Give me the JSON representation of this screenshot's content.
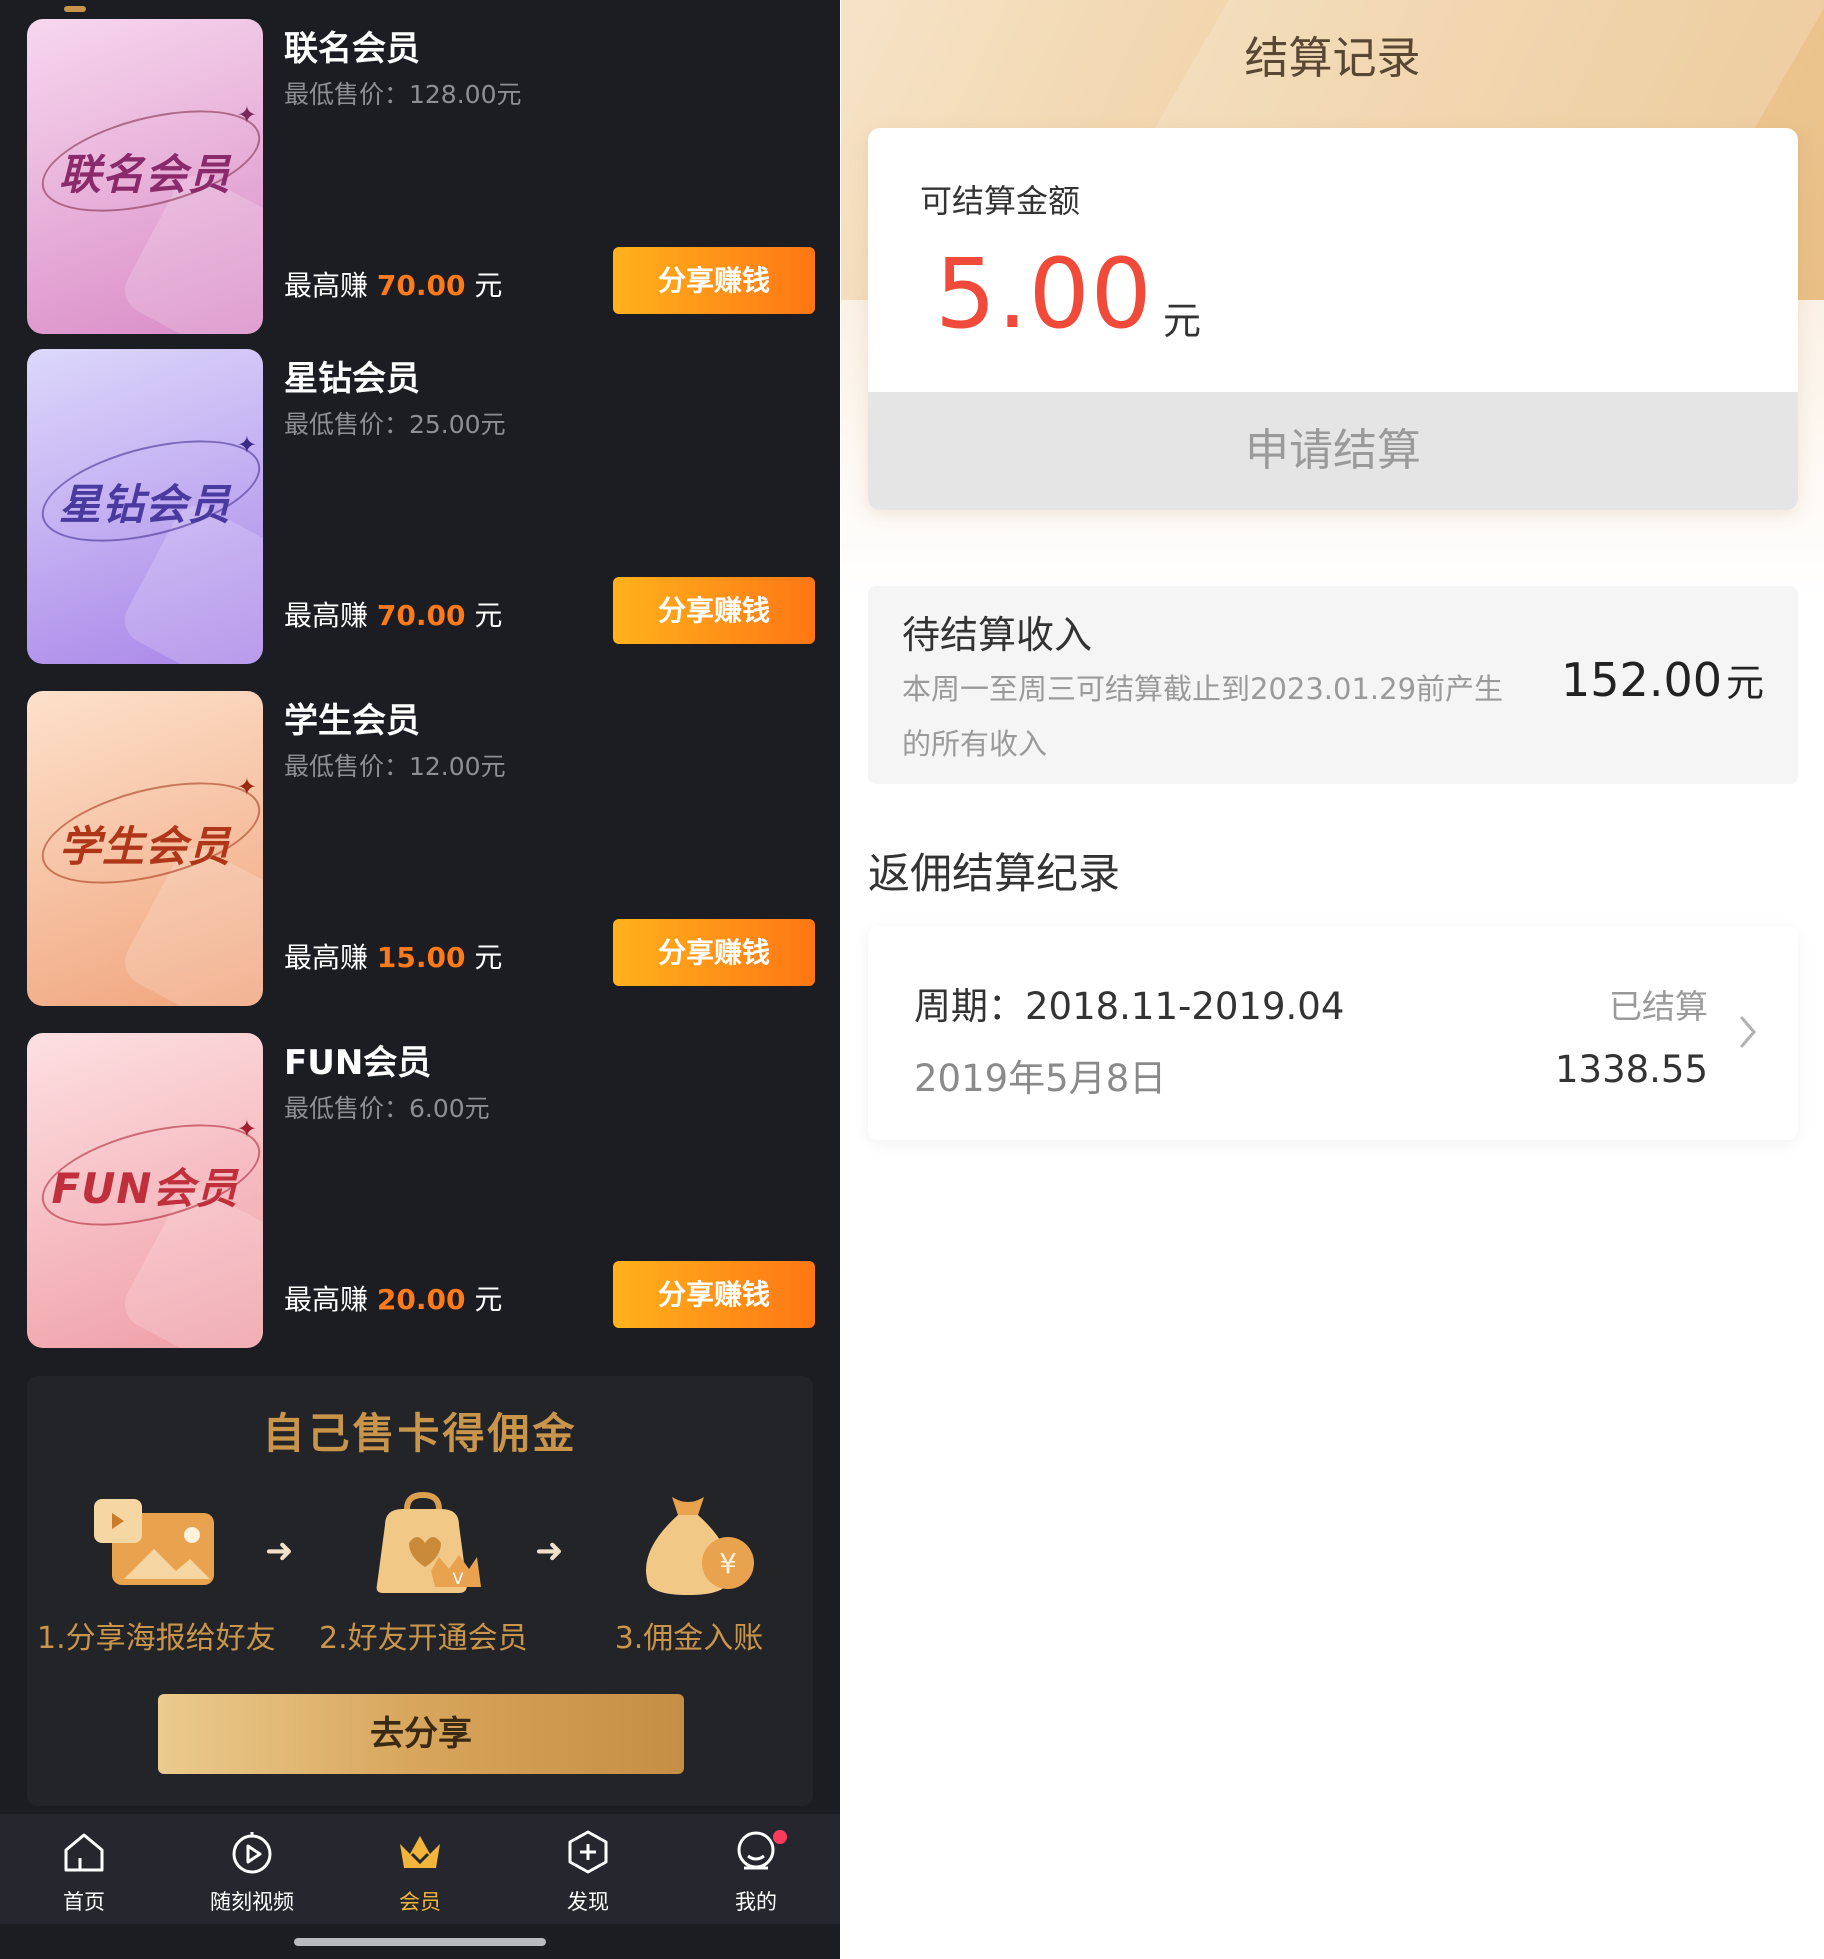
{
  "left": {
    "cards": [
      {
        "name": "联名会员",
        "thumb_text": "联名会员",
        "min_price": "最低售价：128.00元",
        "earn_prefix": "最高赚 ",
        "earn_amount": "70.00",
        "earn_unit": " 元",
        "button": "分享赚钱",
        "thumb_gradient": [
          "#f7d7ee",
          "#d98bc6"
        ],
        "thumb_text_color": "#8a2a6a"
      },
      {
        "name": "星钻会员",
        "thumb_text": "星钻会员",
        "min_price": "最低售价：25.00元",
        "earn_prefix": "最高赚 ",
        "earn_amount": "70.00",
        "earn_unit": " 元",
        "button": "分享赚钱",
        "thumb_gradient": [
          "#dcd8fb",
          "#a985e8"
        ],
        "thumb_text_color": "#4a3aa0"
      },
      {
        "name": "学生会员",
        "thumb_text": "学生会员",
        "min_price": "最低售价：12.00元",
        "earn_prefix": "最高赚 ",
        "earn_amount": "15.00",
        "earn_unit": " 元",
        "button": "分享赚钱",
        "thumb_gradient": [
          "#fde1cb",
          "#f0a47c"
        ],
        "thumb_text_color": "#b0361a"
      },
      {
        "name": "FUN会员",
        "thumb_text": "FUN会员",
        "min_price": "最低售价：6.00元",
        "earn_prefix": "最高赚 ",
        "earn_amount": "20.00",
        "earn_unit": " 元",
        "button": "分享赚钱",
        "thumb_gradient": [
          "#fde0e2",
          "#ef9da6"
        ],
        "thumb_text_color": "#c0303c"
      }
    ],
    "promo": {
      "title": "自己售卡得佣金",
      "steps": [
        {
          "label": "1.分享海报给好友",
          "icon": "poster-share-icon"
        },
        {
          "label": "2.好友开通会员",
          "icon": "member-bag-icon"
        },
        {
          "label": "3.佣金入账",
          "icon": "money-bag-icon"
        }
      ],
      "button": "去分享"
    },
    "tabbar": [
      {
        "label": "首页",
        "icon": "home-icon",
        "active": false
      },
      {
        "label": "随刻视频",
        "icon": "video-play-icon",
        "active": false
      },
      {
        "label": "会员",
        "icon": "crown-icon",
        "active": true
      },
      {
        "label": "发现",
        "icon": "discover-plus-icon",
        "active": false
      },
      {
        "label": "我的",
        "icon": "profile-icon",
        "active": false,
        "badge_dot": true
      }
    ]
  },
  "right": {
    "title": "结算记录",
    "balance": {
      "label": "可结算金额",
      "value": "5.00",
      "unit": "元",
      "apply_button": "申请结算"
    },
    "pending": {
      "title": "待结算收入",
      "description": "本周一至周三可结算截止到2023.01.29前产生的所有收入",
      "amount": "152.00",
      "unit": "元"
    },
    "records_title": "返佣结算纪录",
    "records": [
      {
        "period": "周期：2018.11-2019.04",
        "date": "2019年5月8日",
        "status": "已结算",
        "amount": "1338.55"
      }
    ]
  },
  "colors": {
    "accent_orange": "#ff7a1a",
    "gold": "#c9954a",
    "amount_red": "#f04b3a"
  }
}
